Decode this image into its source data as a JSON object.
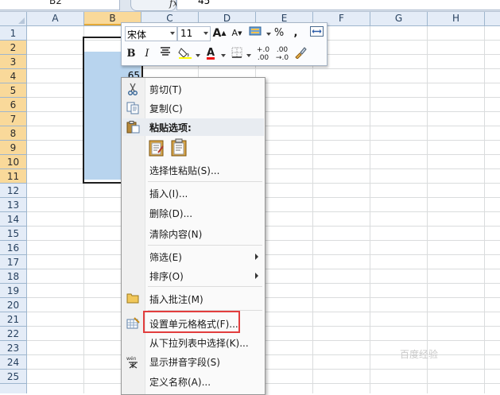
{
  "formula_bar": {
    "name_box": "B2",
    "fx_label": "fx",
    "value": "45"
  },
  "columns": [
    "A",
    "B",
    "C",
    "D",
    "E",
    "F",
    "G",
    "H"
  ],
  "selected_column": "B",
  "rows": [
    "1",
    "2",
    "3",
    "4",
    "5",
    "6",
    "7",
    "8",
    "9",
    "10",
    "11",
    "12",
    "13",
    "14",
    "15",
    "16",
    "17",
    "18",
    "19",
    "20",
    "21",
    "22",
    "23",
    "24",
    "25"
  ],
  "selected_rows": [
    "2",
    "3",
    "4",
    "5",
    "6",
    "7",
    "8",
    "9",
    "10",
    "11"
  ],
  "visible_cell": {
    "ref": "B4",
    "value": "65"
  },
  "mini_toolbar": {
    "font_name": "宋体",
    "font_size": "11",
    "grow_font": "A",
    "shrink_font": "A",
    "percent": "%",
    "comma": ",",
    "bold": "B",
    "italic": "I",
    "font_color": "A",
    "increase_decimal": "+.0 .00",
    "decrease_decimal": ".00 →.0"
  },
  "context_menu": {
    "items": [
      {
        "label": "剪切(T)",
        "icon": "scissors-icon"
      },
      {
        "label": "复制(C)",
        "icon": "copy-icon"
      },
      {
        "label": "粘贴选项:",
        "icon": "paste-icon"
      },
      {
        "label": "选择性粘贴(S)...",
        "icon": ""
      },
      {
        "label": "插入(I)...",
        "icon": ""
      },
      {
        "label": "删除(D)...",
        "icon": ""
      },
      {
        "label": "清除内容(N)",
        "icon": ""
      },
      {
        "label": "筛选(E)",
        "icon": ""
      },
      {
        "label": "排序(O)",
        "icon": ""
      },
      {
        "label": "插入批注(M)",
        "icon": "comment-icon"
      },
      {
        "label": "设置单元格格式(F)...",
        "icon": "format-cells-icon"
      },
      {
        "label": "从下拉列表中选择(K)...",
        "icon": ""
      },
      {
        "label": "显示拼音字段(S)",
        "icon": "phonetic-icon"
      },
      {
        "label": "定义名称(A)...",
        "icon": ""
      }
    ]
  },
  "watermark": "百度经验",
  "colors": {
    "selection": "#b8d4ee",
    "header_selected": "#f9d99a",
    "highlight_box": "#e23d3d"
  }
}
